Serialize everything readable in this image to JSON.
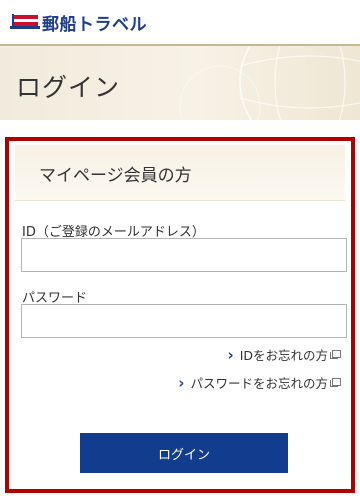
{
  "brand": {
    "name": "郵船トラベル",
    "logo_icon": "flag-logo-icon"
  },
  "banner": {
    "title": "ログイン"
  },
  "form": {
    "section_title": "マイページ会員の方",
    "id_label": "ID（ご登録のメールアドレス）",
    "id_value": "",
    "password_label": "パスワード",
    "password_value": "",
    "forgot_id_link": "IDをお忘れの方",
    "forgot_password_link": "パスワードをお忘れの方",
    "login_button": "ログイン"
  },
  "colors": {
    "brand_blue": "#1f3c8c",
    "panel_border_red": "#b00000",
    "button_blue": "#123d8f",
    "banner_beige": "#f3ede0"
  }
}
